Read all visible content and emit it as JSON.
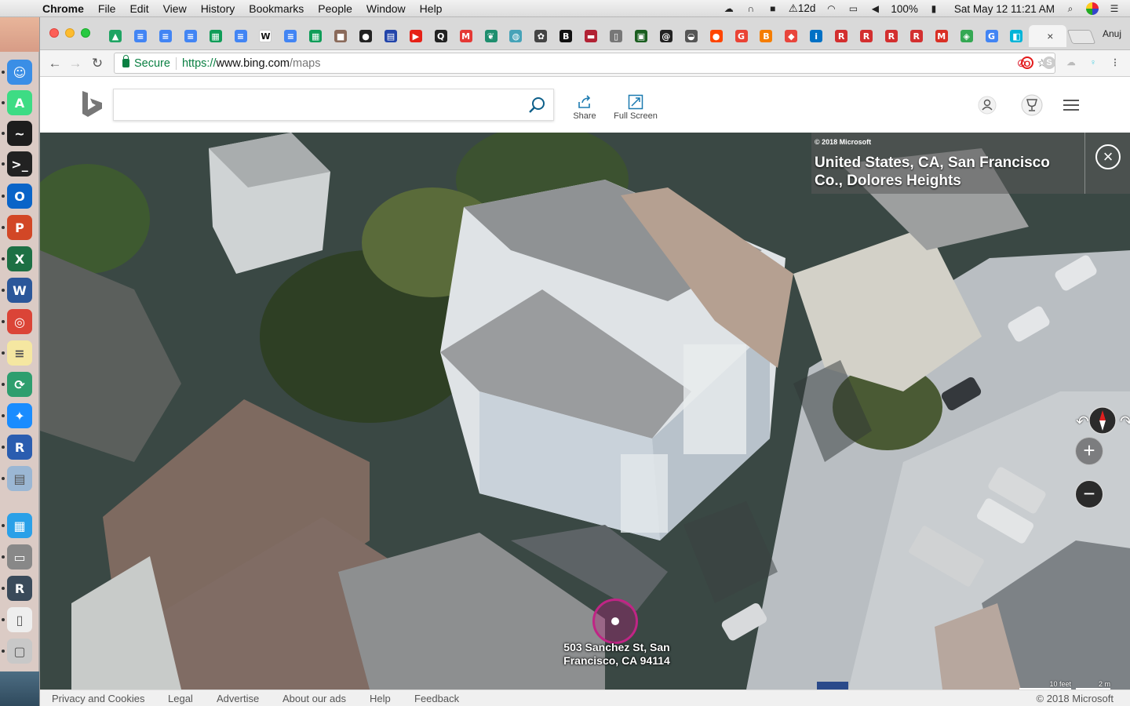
{
  "menubar": {
    "app_name": "Chrome",
    "menus": [
      "File",
      "Edit",
      "View",
      "History",
      "Bookmarks",
      "People",
      "Window",
      "Help"
    ],
    "status": {
      "notification_badge": "12d",
      "battery": "100%",
      "datetime": "Sat May 12  11:21 AM"
    }
  },
  "browser": {
    "profile_name": "Anuj",
    "tabs": [
      {
        "icon": "drive-icon",
        "glyph": "▲",
        "color": "#1fa463"
      },
      {
        "icon": "docs-icon",
        "glyph": "≡",
        "color": "#4285f4"
      },
      {
        "icon": "docs-icon",
        "glyph": "≡",
        "color": "#4285f4"
      },
      {
        "icon": "docs-icon",
        "glyph": "≡",
        "color": "#4285f4"
      },
      {
        "icon": "sheets-icon",
        "glyph": "▦",
        "color": "#0f9d58"
      },
      {
        "icon": "docs-icon",
        "glyph": "≡",
        "color": "#4285f4"
      },
      {
        "icon": "wikipedia-icon",
        "glyph": "W",
        "color": "#ffffff"
      },
      {
        "icon": "docs-icon",
        "glyph": "≡",
        "color": "#4285f4"
      },
      {
        "icon": "sheets-icon",
        "glyph": "▦",
        "color": "#0f9d58"
      },
      {
        "icon": "photo-icon",
        "glyph": "■",
        "color": "#8a6a5a"
      },
      {
        "icon": "github-icon",
        "glyph": "●",
        "color": "#222222"
      },
      {
        "icon": "keyboard-icon",
        "glyph": "▤",
        "color": "#2244aa"
      },
      {
        "icon": "youtube-icon",
        "glyph": "▶",
        "color": "#e62117"
      },
      {
        "icon": "quora-icon",
        "glyph": "Q",
        "color": "#222222"
      },
      {
        "icon": "app-icon",
        "glyph": "M",
        "color": "#e53935"
      },
      {
        "icon": "leaf-icon",
        "glyph": "❦",
        "color": "#1e8e6e"
      },
      {
        "icon": "globe-icon",
        "glyph": "◍",
        "color": "#46a3b8"
      },
      {
        "icon": "puzzle-icon",
        "glyph": "✿",
        "color": "#444444"
      },
      {
        "icon": "bold-b-icon",
        "glyph": "B",
        "color": "#111111"
      },
      {
        "icon": "flag-icon",
        "glyph": "▬",
        "color": "#b22234"
      },
      {
        "icon": "page-icon",
        "glyph": "▯",
        "color": "#777777"
      },
      {
        "icon": "terminal-icon",
        "glyph": "▣",
        "color": "#1b5e20"
      },
      {
        "icon": "swirl-icon",
        "glyph": "@",
        "color": "#222222"
      },
      {
        "icon": "cat-icon",
        "glyph": "◒",
        "color": "#555555"
      },
      {
        "icon": "reddit-icon",
        "glyph": "●",
        "color": "#ff4500"
      },
      {
        "icon": "google-icon",
        "glyph": "G",
        "color": "#ea4335"
      },
      {
        "icon": "blogger-icon",
        "glyph": "B",
        "color": "#f57d00"
      },
      {
        "icon": "app-icon",
        "glyph": "◆",
        "color": "#e8453c"
      },
      {
        "icon": "intel-icon",
        "glyph": "i",
        "color": "#0071c5"
      },
      {
        "icon": "r-letter-icon",
        "glyph": "R",
        "color": "#d32f2f"
      },
      {
        "icon": "r-letter-icon",
        "glyph": "R",
        "color": "#d32f2f"
      },
      {
        "icon": "r-letter-icon",
        "glyph": "R",
        "color": "#d32f2f"
      },
      {
        "icon": "r-letter-icon",
        "glyph": "R",
        "color": "#d32f2f"
      },
      {
        "icon": "gmail-icon",
        "glyph": "M",
        "color": "#d93025"
      },
      {
        "icon": "maps-icon",
        "glyph": "◈",
        "color": "#34a853"
      },
      {
        "icon": "google-icon",
        "glyph": "G",
        "color": "#4285f4"
      },
      {
        "icon": "bing-maps-icon",
        "glyph": "◧",
        "color": "#00b4d8"
      }
    ],
    "active_tab_close": "×",
    "omnibox": {
      "secure_label": "Secure",
      "url_scheme": "https://",
      "url_host": "www.bing.com",
      "url_path": "/maps"
    }
  },
  "bing": {
    "search": {
      "value": "",
      "placeholder": ""
    },
    "share_label": "Share",
    "fullscreen_label": "Full Screen"
  },
  "map": {
    "copyright_small": "© 2018 Microsoft",
    "location_title": "United States, CA, San Francisco Co., Dolores Heights",
    "pin_label": "503 Sanchez St, San Francisco, CA 94114",
    "scale_feet": "10 feet",
    "scale_meters": "2 m",
    "zoom_in": "+",
    "zoom_out": "−",
    "close": "×",
    "rotate_left": "↶",
    "rotate_right": "↷"
  },
  "footer": {
    "links": [
      "Privacy and Cookies",
      "Legal",
      "Advertise",
      "About our ads",
      "Help",
      "Feedback"
    ],
    "copyright": "© 2018 Microsoft"
  },
  "dock": [
    {
      "name": "finder-icon",
      "color": "#3a8ee6",
      "glyph": "☺"
    },
    {
      "name": "android-studio-icon",
      "color": "#3ddc84",
      "glyph": "A"
    },
    {
      "name": "activity-monitor-icon",
      "color": "#1d1d1d",
      "glyph": "~"
    },
    {
      "name": "terminal-icon",
      "color": "#222222",
      "glyph": ">_"
    },
    {
      "name": "outlook-icon",
      "color": "#0a64c8",
      "glyph": "O"
    },
    {
      "name": "powerpoint-icon",
      "color": "#d24726",
      "glyph": "P"
    },
    {
      "name": "excel-icon",
      "color": "#1d7044",
      "glyph": "X"
    },
    {
      "name": "word-icon",
      "color": "#2b579a",
      "glyph": "W"
    },
    {
      "name": "chrome-icon",
      "color": "#db4437",
      "glyph": "◎"
    },
    {
      "name": "notes-icon",
      "color": "#f5e7a1",
      "glyph": "≡"
    },
    {
      "name": "sync-icon",
      "color": "#2e9e6e",
      "glyph": "⟳"
    },
    {
      "name": "safari-icon",
      "color": "#1a8cff",
      "glyph": "✦"
    },
    {
      "name": "r-app-icon",
      "color": "#2a5db0",
      "glyph": "R"
    },
    {
      "name": "preview-icon",
      "color": "#9bb7d4",
      "glyph": "▤"
    },
    {
      "name": "windows-icon",
      "color": "#2aa0e8",
      "glyph": "▦"
    },
    {
      "name": "printer-icon",
      "color": "#888888",
      "glyph": "▭"
    },
    {
      "name": "rstudio-icon",
      "color": "#3a4a5a",
      "glyph": "R"
    },
    {
      "name": "document-icon",
      "color": "#eeeeee",
      "glyph": "▯"
    },
    {
      "name": "trash-icon",
      "color": "#c8c8c8",
      "glyph": "▢"
    }
  ]
}
